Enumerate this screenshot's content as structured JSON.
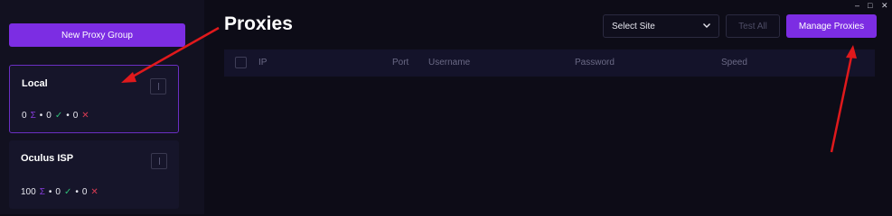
{
  "sidebar": {
    "new_group_label": "New Proxy Group",
    "groups": [
      {
        "name": "Local",
        "total": "0",
        "ok": "0",
        "bad": "0"
      },
      {
        "name": "Oculus ISP",
        "total": "100",
        "ok": "0",
        "bad": "0"
      }
    ],
    "symbols": {
      "total": "Σ",
      "ok": "✓",
      "bad": "✕",
      "sep": "•"
    }
  },
  "main": {
    "title": "Proxies",
    "select_site_label": "Select Site",
    "test_all_label": "Test All",
    "manage_label": "Manage Proxies",
    "columns": [
      "IP",
      "Port",
      "Username",
      "Password",
      "Speed"
    ]
  },
  "window": {
    "minimize": "–",
    "maximize": "□",
    "close": "✕"
  },
  "colors": {
    "accent": "#7c2de3",
    "background": "#0d0c17",
    "sidebar": "#121120",
    "ok": "#2fbf78",
    "bad": "#d83a52",
    "annotation": "#e0191c"
  }
}
